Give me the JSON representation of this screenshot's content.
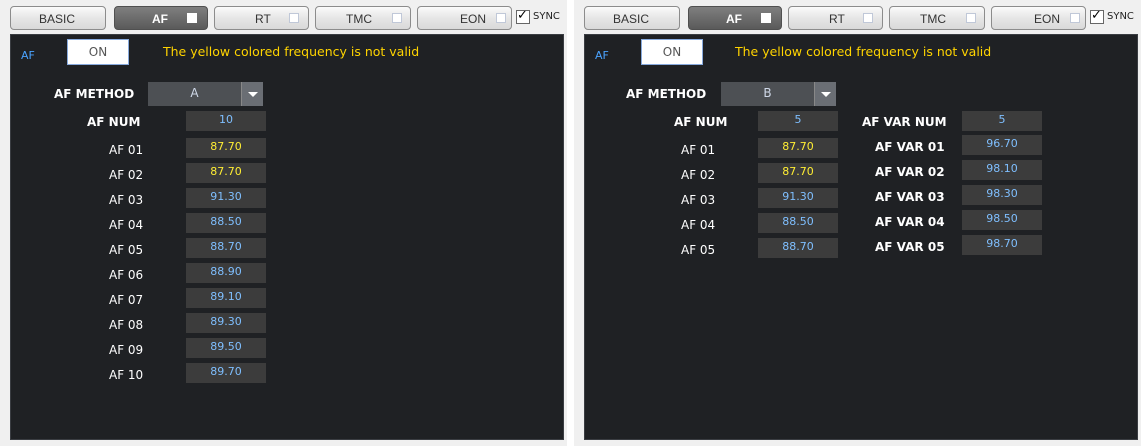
{
  "tabs": [
    {
      "label": "BASIC",
      "has_indicator": false,
      "active": false
    },
    {
      "label": "AF",
      "has_indicator": true,
      "active": true
    },
    {
      "label": "RT",
      "has_indicator": true,
      "active": false
    },
    {
      "label": "TMC",
      "has_indicator": true,
      "active": false
    },
    {
      "label": "EON",
      "has_indicator": true,
      "active": false
    }
  ],
  "sync": {
    "label": "SYNC",
    "checked": true
  },
  "colors": {
    "accent_blue": "#4aa3ff",
    "warning_yellow": "#ffd400",
    "field_value_blue": "#7fbfff",
    "invalid_value_yellow": "#ffee33",
    "panel_bg": "#1f2124"
  },
  "panels": [
    {
      "af_label": "AF",
      "on_button": "ON",
      "warning": "The yellow colored frequency is not valid",
      "method_label": "AF METHOD",
      "method_value": "A",
      "num_label": "AF NUM",
      "num_value": "10",
      "af_rows": [
        {
          "label": "AF 01",
          "value": "87.70",
          "invalid": true
        },
        {
          "label": "AF 02",
          "value": "87.70",
          "invalid": true
        },
        {
          "label": "AF 03",
          "value": "91.30",
          "invalid": false
        },
        {
          "label": "AF 04",
          "value": "88.50",
          "invalid": false
        },
        {
          "label": "AF 05",
          "value": "88.70",
          "invalid": false
        },
        {
          "label": "AF 06",
          "value": "88.90",
          "invalid": false
        },
        {
          "label": "AF 07",
          "value": "89.10",
          "invalid": false
        },
        {
          "label": "AF 08",
          "value": "89.30",
          "invalid": false
        },
        {
          "label": "AF 09",
          "value": "89.50",
          "invalid": false
        },
        {
          "label": "AF 10",
          "value": "89.70",
          "invalid": false
        }
      ]
    },
    {
      "af_label": "AF",
      "on_button": "ON",
      "warning": "The yellow colored frequency is not valid",
      "method_label": "AF METHOD",
      "method_value": "B",
      "num_label": "AF NUM",
      "num_value": "5",
      "var_num_label": "AF VAR NUM",
      "var_num_value": "5",
      "af_rows": [
        {
          "label": "AF 01",
          "value": "87.70",
          "invalid": true
        },
        {
          "label": "AF 02",
          "value": "87.70",
          "invalid": true
        },
        {
          "label": "AF 03",
          "value": "91.30",
          "invalid": false
        },
        {
          "label": "AF 04",
          "value": "88.50",
          "invalid": false
        },
        {
          "label": "AF 05",
          "value": "88.70",
          "invalid": false
        }
      ],
      "var_rows": [
        {
          "label": "AF VAR 01",
          "value": "96.70"
        },
        {
          "label": "AF VAR 02",
          "value": "98.10"
        },
        {
          "label": "AF VAR 03",
          "value": "98.30"
        },
        {
          "label": "AF VAR 04",
          "value": "98.50"
        },
        {
          "label": "AF VAR 05",
          "value": "98.70"
        }
      ]
    }
  ]
}
